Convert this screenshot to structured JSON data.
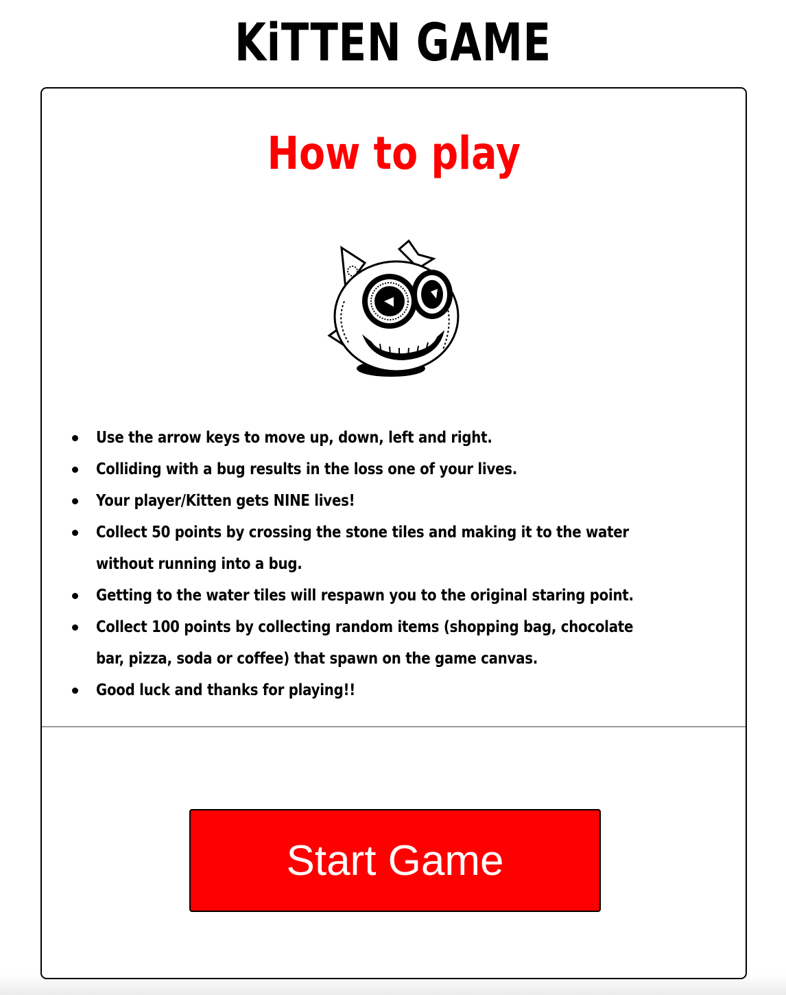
{
  "game": {
    "title": "KiTTEN GAME"
  },
  "instructions": {
    "heading": "How to play",
    "rules": [
      "Use the arrow keys to move up, down, left and right.",
      "Colliding with a bug results in the loss one of your lives.",
      "Your player/Kitten gets NINE lives!",
      "Collect 50 points by crossing the stone tiles and making it to the water",
      "without running into a bug.",
      "Getting to the water tiles will respawn you to the original staring point.",
      "Collect 100 points by collecting random items (shopping bag, chocolate",
      "bar, pizza, soda or coffee) that spawn on the game canvas.",
      "Good luck and thanks for playing!!"
    ]
  },
  "start_button": {
    "label": "Start Game"
  },
  "colors": {
    "accent": "#ff0000",
    "text": "#000000",
    "button_text": "#ffffff",
    "background": "#ffffff"
  },
  "icons": {
    "mascot": "kitten-skull-icon"
  }
}
